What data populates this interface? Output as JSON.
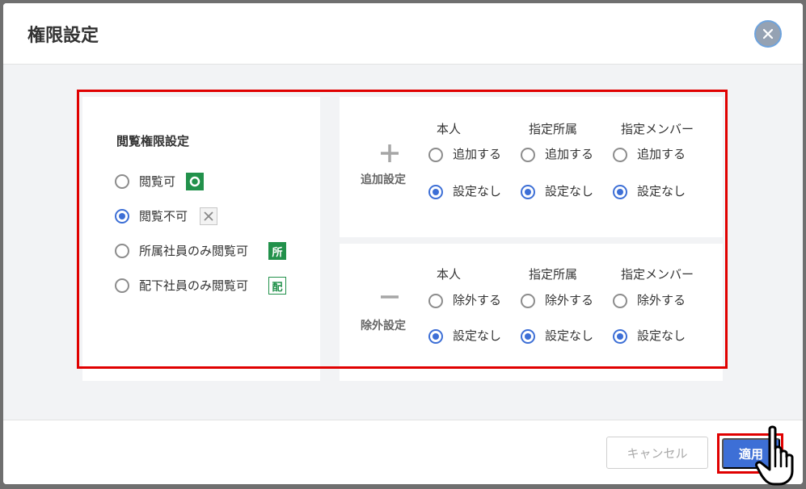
{
  "dialog": {
    "title": "権限設定",
    "close_icon": "close-icon"
  },
  "view_permission": {
    "title": "閲覧権限設定",
    "options": [
      {
        "label": "閲覧可",
        "badge_icon": "circle-icon",
        "checked": false
      },
      {
        "label": "閲覧不可",
        "badge_icon": "cross-icon",
        "checked": true
      },
      {
        "label": "所属社員のみ閲覧可",
        "badge_text": "所",
        "checked": false
      },
      {
        "label": "配下社員のみ閲覧可",
        "badge_text": "配",
        "checked": false
      }
    ]
  },
  "add_settings": {
    "sign_icon": "plus-icon",
    "label": "追加設定",
    "columns": [
      {
        "header": "本人",
        "option1": "追加する",
        "option2": "設定なし"
      },
      {
        "header": "指定所属",
        "option1": "追加する",
        "option2": "設定なし"
      },
      {
        "header": "指定メンバー",
        "option1": "追加する",
        "option2": "設定なし"
      }
    ]
  },
  "remove_settings": {
    "sign_icon": "minus-icon",
    "label": "除外設定",
    "columns": [
      {
        "header": "本人",
        "option1": "除外する",
        "option2": "設定なし"
      },
      {
        "header": "指定所属",
        "option1": "除外する",
        "option2": "設定なし"
      },
      {
        "header": "指定メンバー",
        "option1": "除外する",
        "option2": "設定なし"
      }
    ]
  },
  "footer": {
    "cancel_label": "キャンセル",
    "apply_label": "適用"
  },
  "colors": {
    "accent": "#3d6fd6",
    "highlight": "#e00000",
    "badge_green": "#22914b"
  }
}
